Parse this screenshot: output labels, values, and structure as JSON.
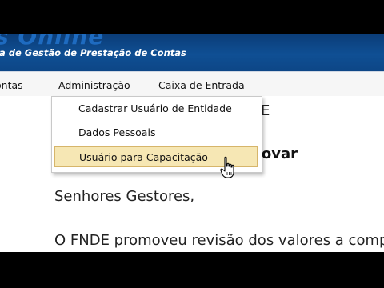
{
  "banner": {
    "logo_text": "s Online",
    "subtitle": "a de Gestão de Prestação de Contas"
  },
  "menubar": {
    "items": [
      {
        "label": "ontas"
      },
      {
        "label": "Administração"
      },
      {
        "label": "Caixa de Entrada"
      }
    ]
  },
  "dropdown": {
    "items": [
      {
        "label": "Cadastrar Usuário de Entidade"
      },
      {
        "label": "Dados Pessoais"
      },
      {
        "label": "Usuário para Capacitação"
      }
    ]
  },
  "content": {
    "partial_heading_1": "E",
    "partial_heading_2": "rovar",
    "greeting": "Senhores Gestores,",
    "paragraph": "O FNDE promoveu revisão dos valores a comp"
  },
  "colors": {
    "banner_blue": "#0f4f94",
    "highlight": "#f6e7b4",
    "highlight_border": "#d6b56a"
  }
}
